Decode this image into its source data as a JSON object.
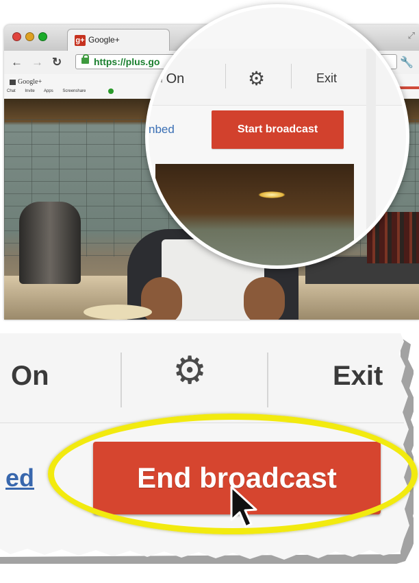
{
  "browser": {
    "tab_title": "Google+",
    "tab_favicon": "g+",
    "url": "https://plus.go",
    "mini_logo": "Google+",
    "mini_links": "Chat Invite Apps Screenshare"
  },
  "magnifier": {
    "on_label": "On",
    "settings_icon": "gear-icon",
    "exit_label": "Exit",
    "embed_partial": "nbed",
    "start_broadcast_label": "Start broadcast"
  },
  "detail": {
    "on_label": "On",
    "settings_icon": "gear-icon",
    "exit_label": "Exit",
    "embed_partial": "ed",
    "end_broadcast_label": "End broadcast",
    "highlight_color": "#f2ea0f",
    "button_color": "#d6452f"
  }
}
